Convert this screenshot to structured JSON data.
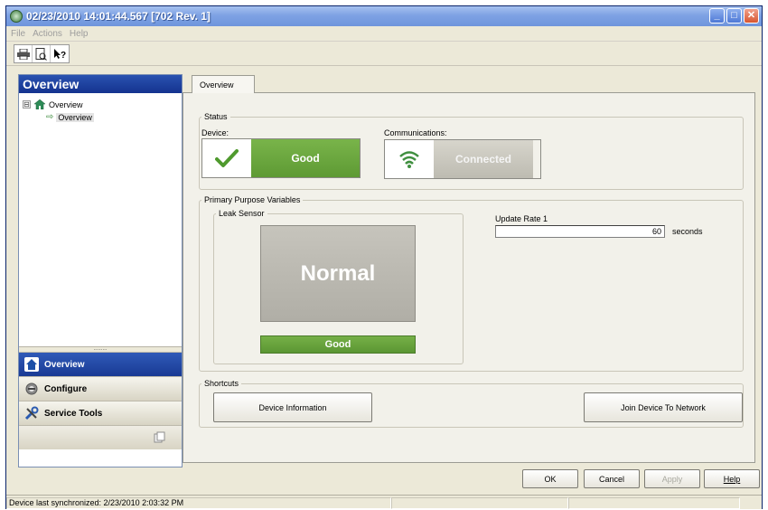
{
  "window": {
    "title": "02/23/2010 14:01:44.567 [702 Rev. 1]"
  },
  "menu": {
    "items": [
      "File",
      "Actions",
      "Help"
    ]
  },
  "toolbar": {
    "icons": [
      "printer-icon",
      "print-preview-icon",
      "context-help-icon"
    ]
  },
  "nav": {
    "header": "Overview",
    "tree": {
      "root_label": "Overview",
      "expander": "⊟",
      "child_label": "Overview"
    },
    "buttons": [
      {
        "label": "Overview",
        "icon": "home-icon"
      },
      {
        "label": "Configure",
        "icon": "configure-icon"
      },
      {
        "label": "Service Tools",
        "icon": "tools-icon"
      }
    ]
  },
  "tab": {
    "label": "Overview"
  },
  "status": {
    "group_label": "Status",
    "device_label": "Device:",
    "device_value": "Good",
    "comms_label": "Communications:",
    "comms_value": "Connected"
  },
  "ppv": {
    "group_label": "Primary Purpose Variables",
    "sensor_group_label": "Leak Sensor",
    "sensor_value": "Normal",
    "sensor_status": "Good",
    "update_rate_label": "Update Rate 1",
    "update_rate_value": "60",
    "update_rate_unit": "seconds"
  },
  "shortcuts": {
    "group_label": "Shortcuts",
    "device_info": "Device Information",
    "join_network": "Join Device To Network"
  },
  "dialog_buttons": {
    "ok": "OK",
    "cancel": "Cancel",
    "apply": "Apply",
    "help": "Help"
  },
  "statusbar": {
    "text": "Device last synchronized: 2/23/2010 2:03:32 PM"
  },
  "colors": {
    "good_green": "#6aa63d",
    "title_blue": "#7ea2e4",
    "nav_blue": "#1f45a3",
    "connected_gray": "#c7c5bc"
  }
}
